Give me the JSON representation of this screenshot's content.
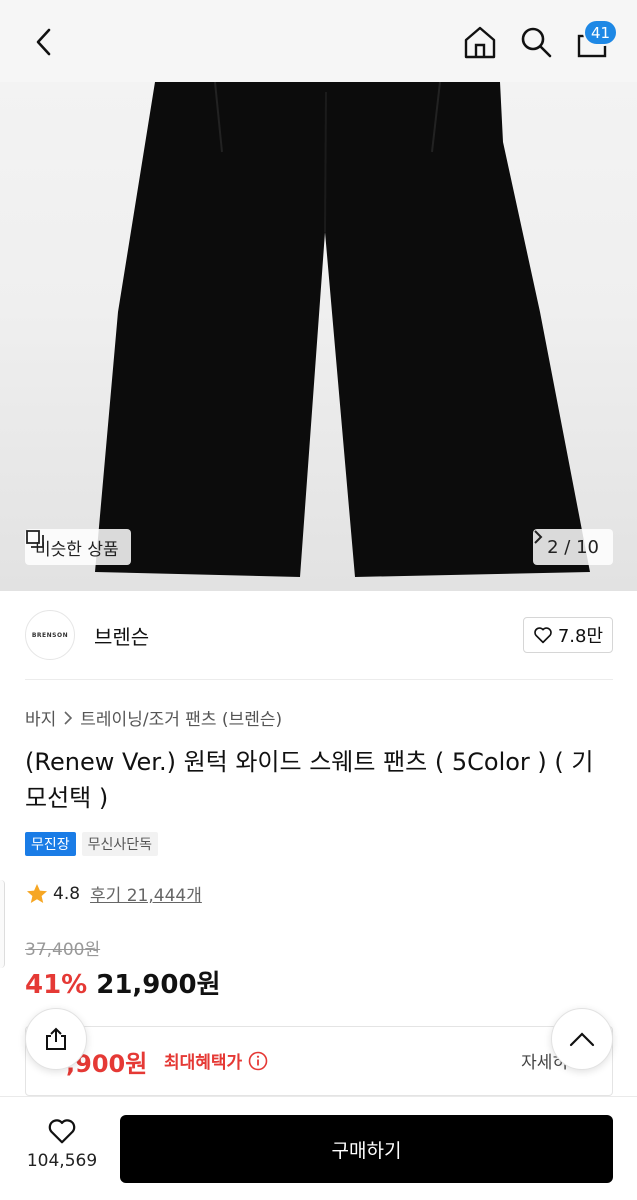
{
  "header": {
    "cart_count": "41",
    "icons": [
      "back-icon",
      "home-icon",
      "search-icon",
      "shopping-bag-icon"
    ]
  },
  "gallery": {
    "similar_label": "비슷한 상품",
    "counter": "2 / 10"
  },
  "brand": {
    "logo_text": "BRENSON",
    "name": "브렌슨",
    "likes": "7.8만"
  },
  "breadcrumb": {
    "level1": "바지",
    "level2": "트레이닝/조거 팬츠 (브렌슨)"
  },
  "product": {
    "title": "(Renew Ver.) 원턱 와이드 스웨트 팬츠 ( 5Color ) ( 기모선택 )",
    "tags": [
      "무진장",
      "무신사단독"
    ],
    "rating": "4.8",
    "reviews": "후기 21,444개"
  },
  "pricing": {
    "original": "37,400원",
    "discount": "41%",
    "price": "21,900원",
    "benefit_price": ",900원",
    "benefit_label": "최대혜택가",
    "benefit_detail": "자세히"
  },
  "bottom": {
    "wish_count": "104,569",
    "buy_label": "구매하기"
  }
}
